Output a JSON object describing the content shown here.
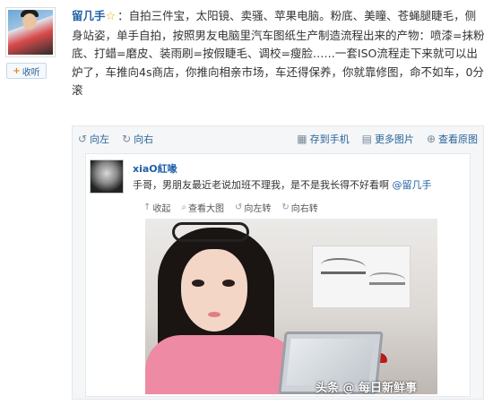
{
  "author": {
    "username": "留几手",
    "follow_label": "收听"
  },
  "post": {
    "text": "：自拍三件宝，太阳镜、卖骚、苹果电脑。粉底、美瞳、苍蝇腿睫毛，侧身站姿，单手自拍，按照男友电脑里汽车图纸生产制造流程出来的产物：喷漆=抹粉底、打蜡=磨皮、装雨刷=按假睫毛、调校=瘦脸……一套ISO流程走下来就可以出炉了，车推向4s商店，你推向相亲市场，车还得保养，你就靠修图，命不如车，0分滚"
  },
  "actions": {
    "left": "向左",
    "right": "向右",
    "save_phone": "存到手机",
    "more_images": "更多图片",
    "view_original": "查看原图"
  },
  "repost": {
    "username": "xiaO紅喙",
    "text": "手哥，男朋友最近老说加班不理我，是不是我长得不好看啊",
    "mention": "@留几手"
  },
  "image_toolbar": {
    "collapse": "收起",
    "view_large": "查看大图",
    "rotate_left": "向左转",
    "rotate_right": "向右转"
  },
  "watermark": "头条 @ 每日新鲜事"
}
